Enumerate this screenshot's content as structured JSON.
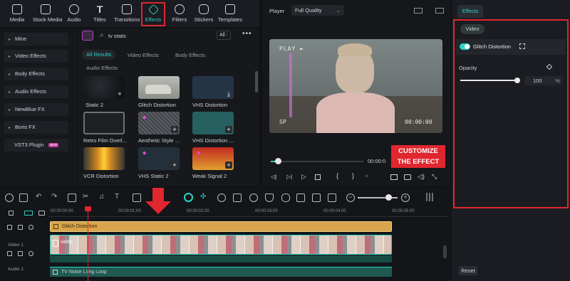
{
  "toolbar": {
    "items": [
      {
        "label": "Media",
        "icon": "media-icon"
      },
      {
        "label": "Stock Media",
        "icon": "stock-media-icon"
      },
      {
        "label": "Audio",
        "icon": "audio-icon"
      },
      {
        "label": "Titles",
        "icon": "titles-icon"
      },
      {
        "label": "Transitions",
        "icon": "transitions-icon"
      },
      {
        "label": "Effects",
        "icon": "effects-icon",
        "active": true
      },
      {
        "label": "Filters",
        "icon": "filters-icon"
      },
      {
        "label": "Stickers",
        "icon": "stickers-icon"
      },
      {
        "label": "Templates",
        "icon": "templates-icon"
      }
    ]
  },
  "leftnav": {
    "items": [
      "Mine",
      "Video Effects",
      "Body Effects",
      "Audio Effects",
      "NewBlue FX",
      "Boris FX",
      "VST3 Plugin"
    ],
    "vst_badge": "NEW"
  },
  "browser": {
    "search_value": "tv static",
    "filter_label": "All",
    "tabs": [
      "All Results",
      "Video Effects",
      "Body Effects",
      "Audio Effects"
    ],
    "items": [
      {
        "label": "Static 2"
      },
      {
        "label": "Glitch Distortion"
      },
      {
        "label": "VHS Distortion"
      },
      {
        "label": "Retro Film Overl..."
      },
      {
        "label": "Aesthetic Style ..."
      },
      {
        "label": "VHS Distortion ..."
      },
      {
        "label": "VCR Distortion"
      },
      {
        "label": "VHS Static 2"
      },
      {
        "label": "Weak Signal 2"
      }
    ]
  },
  "player": {
    "label": "Player",
    "quality": "Full Quality",
    "overlay_play": "PLAY ►",
    "overlay_sp": "SP",
    "overlay_time": "00:00:00",
    "timecode": "00:00:0",
    "progress": 0.08
  },
  "callout": {
    "line1": "CUSTOMIZE",
    "line2": "THE EFFECT"
  },
  "panel": {
    "tab": "Effects",
    "subtab": "Video",
    "effect_name": "Glitch Distortion",
    "opacity_label": "Opacity",
    "opacity_value": "100",
    "opacity_unit": "%",
    "opacity_level": 1.0,
    "reset_label": "Reset"
  },
  "timeline": {
    "ruler": [
      "00:00:00:00",
      "00:00:01:00",
      "00:00:02:00",
      "00:00:03:00",
      "00:00:04:00",
      "00:00:05:00"
    ],
    "effect_clip": "Glitch Distortion",
    "video_track_label": "Video 1",
    "video_clip": "video",
    "audio_track_label": "Audio 1",
    "audio_clip": "TV Noise Long Loop"
  },
  "colors": {
    "accent": "#2bd4c4",
    "callout": "#e0262e",
    "effect_clip": "#d8a54c"
  }
}
